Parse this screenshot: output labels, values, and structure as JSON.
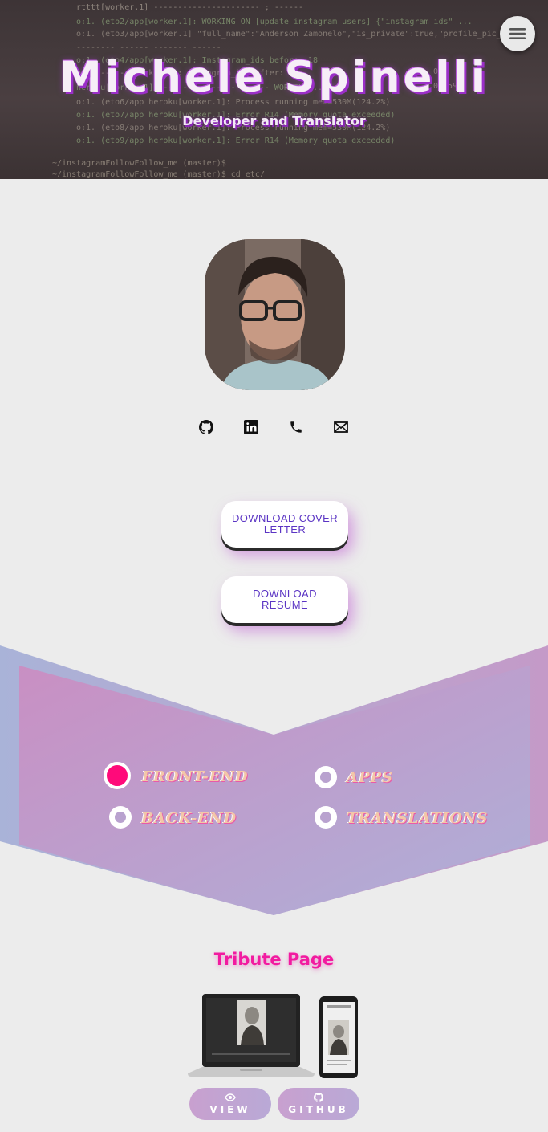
{
  "hero": {
    "name": "Michele Spinelli",
    "subtitle": "Developer and Translator",
    "menu_icon": "hamburger-icon"
  },
  "profile": {
    "avatar_alt": "profile photo",
    "social_icons": [
      "github-icon",
      "linkedin-icon",
      "phone-icon",
      "email-icon"
    ]
  },
  "downloads": {
    "cover_letter": "DOWNLOAD COVER LETTER",
    "resume": "DOWNLOAD RESUME"
  },
  "filters": {
    "items": [
      {
        "label": "FRONT-END",
        "selected": true
      },
      {
        "label": "APPS",
        "selected": false
      },
      {
        "label": "BACK-END",
        "selected": false
      },
      {
        "label": "TRANSLATIONS",
        "selected": false
      }
    ]
  },
  "project": {
    "title": "Tribute Page",
    "view_label": "VIEW",
    "github_label": "GITHUB"
  },
  "colors": {
    "accent_pink": "#f21ba0",
    "button_text": "#5b35c4",
    "radio_active": "#ff0a7a"
  }
}
